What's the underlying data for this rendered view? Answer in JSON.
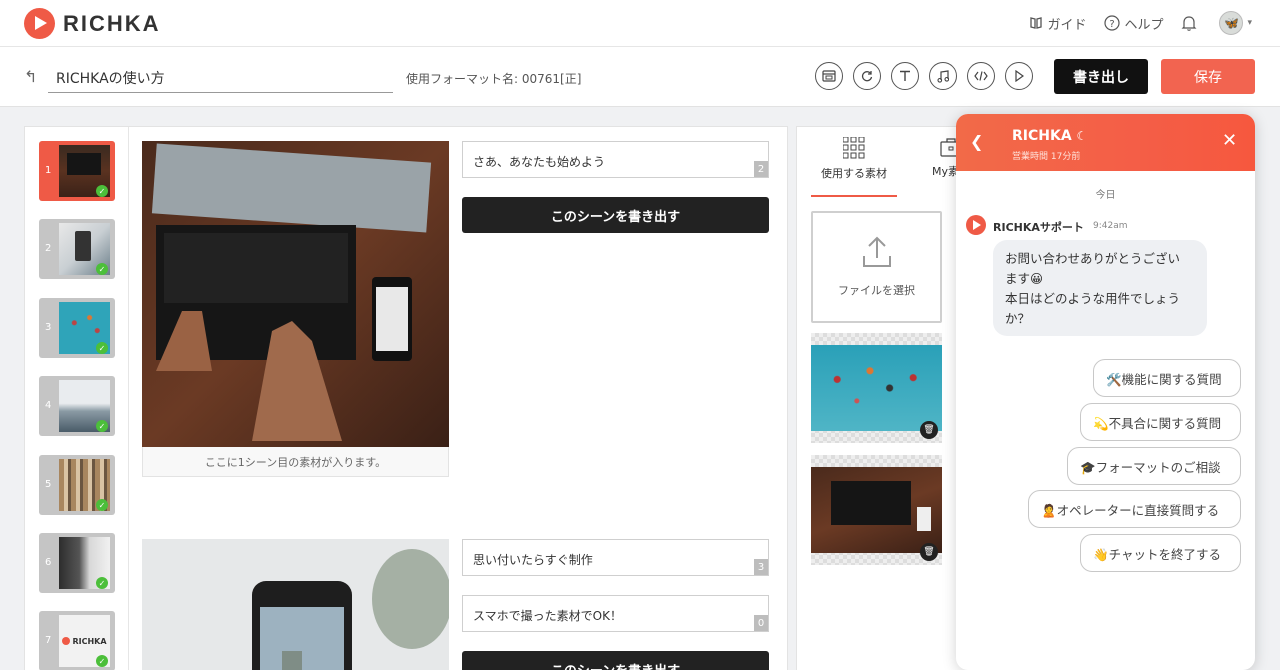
{
  "app": {
    "logo_text": "RICHKA"
  },
  "header": {
    "guide": "ガイド",
    "help": "ヘルプ"
  },
  "project": {
    "title": "RICHKAの使い方",
    "format_label": "使用フォーマット名: 00761[正]"
  },
  "toolbar": {
    "export": "書き出し",
    "save": "保存"
  },
  "thumbnails": [
    {
      "num": "1",
      "active": true
    },
    {
      "num": "2"
    },
    {
      "num": "3"
    },
    {
      "num": "4"
    },
    {
      "num": "5"
    },
    {
      "num": "6"
    },
    {
      "num": "7",
      "logo": "RICHKA"
    }
  ],
  "scenes": {
    "s1": {
      "caption": "ここに1シーン目の素材が入ります。",
      "text1": "さあ、あなたも始めよう",
      "count1": "2",
      "export_btn": "このシーンを書き出す"
    },
    "s2": {
      "text1": "思い付いたらすぐ制作",
      "count1": "3",
      "text2": "スマホで撮った素材でOK！",
      "count2": "0",
      "export_btn": "このシーンを書き出す"
    }
  },
  "materials": {
    "tab_use": "使用する素材",
    "tab_mine": "My素材",
    "file_select": "ファイルを選択"
  },
  "chat": {
    "name": "RICHKA",
    "status": "営業時間 17分前",
    "today": "今日",
    "agent": "RICHKAサポート",
    "time": "9:42am",
    "message_line1": "お問い合わせありがとうござい",
    "message_line2": "ます😀",
    "message_line3": "本日はどのような用件でしょう",
    "message_line4": "か？",
    "options": [
      "🛠️機能に関する質問",
      "💫不具合に関する質問",
      "🎓フォーマットのご相談",
      "🙎オペレーターに直接質問する",
      "👋チャットを終了する"
    ]
  },
  "colors": {
    "brand": "#ef5a46",
    "dark": "#111111"
  }
}
